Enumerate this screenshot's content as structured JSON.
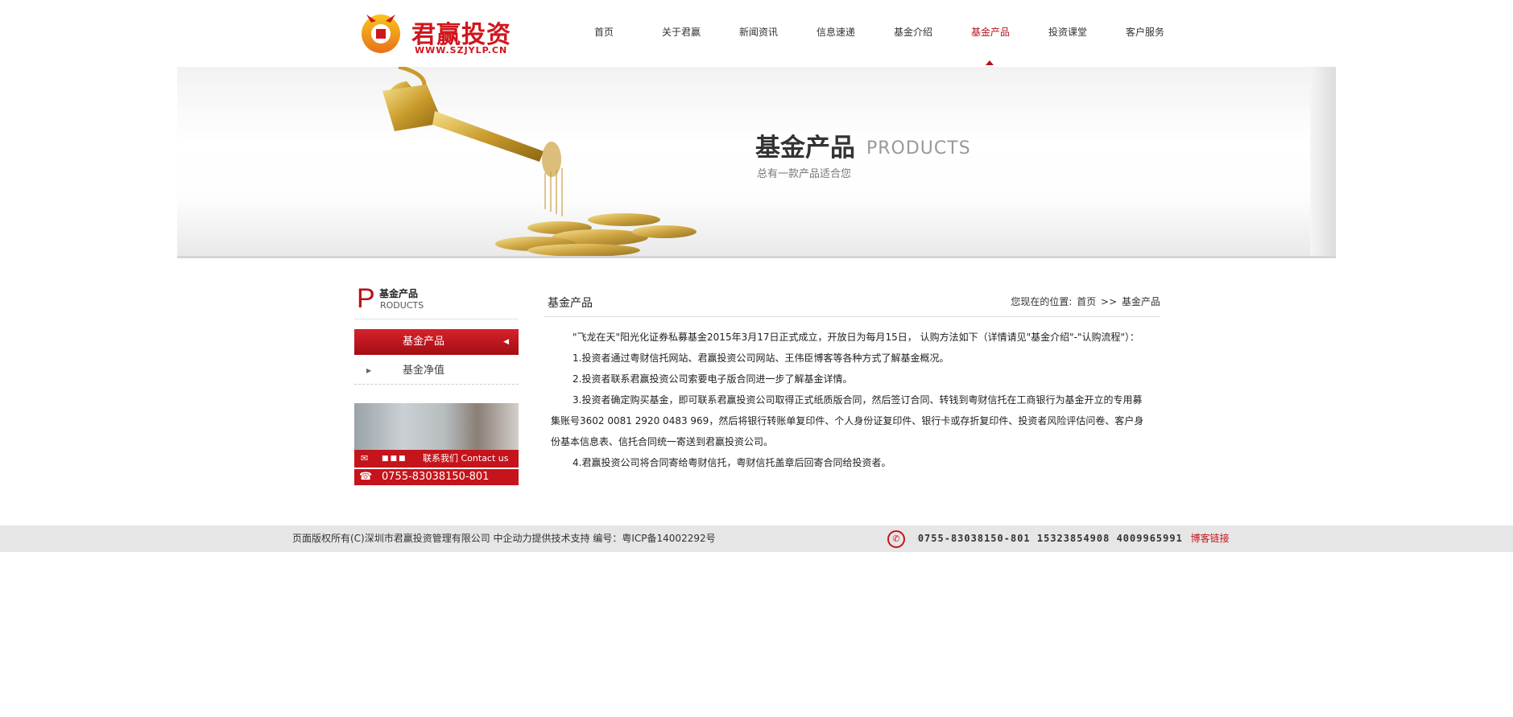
{
  "brand": {
    "name": "君赢投资",
    "url": "WWW.SZJYLP.CN",
    "color": "#d0161d"
  },
  "nav": [
    {
      "label": "首页"
    },
    {
      "label": "关于君赢"
    },
    {
      "label": "新闻资讯"
    },
    {
      "label": "信息速递"
    },
    {
      "label": "基金介绍"
    },
    {
      "label": "基金产品",
      "active": true
    },
    {
      "label": "投资课堂"
    },
    {
      "label": "客户服务"
    }
  ],
  "banner": {
    "title": "基金产品",
    "title_en": "PRODUCTS",
    "subtitle": "总有一款产品适合您"
  },
  "sidebar": {
    "head_p": "P",
    "head_cn": "基金产品",
    "head_en": "RODUCTS",
    "items": [
      {
        "label": "基金产品",
        "active": true
      },
      {
        "label": "基金净值"
      }
    ],
    "contact_label": "联系我们 Contact us",
    "contact_phone": "0755-83038150-801"
  },
  "main": {
    "title": "基金产品",
    "breadcrumb": {
      "prefix": "您现在的位置:",
      "home": "首页",
      "sep": ">>",
      "current": "基金产品"
    },
    "paragraphs": [
      "\"飞龙在天\"阳光化证券私募基金2015年3月17日正式成立，开放日为每月15日， 认购方法如下（详情请见\"基金介绍\"-\"认购流程\"）：",
      "1.投资者通过粤财信托网站、君赢投资公司网站、王伟臣博客等各种方式了解基金概况。",
      "2.投资者联系君赢投资公司索要电子版合同进一步了解基金详情。",
      "3.投资者确定购买基金，即可联系君赢投资公司取得正式纸质版合同，然后签订合同、转钱到粤财信托在工商银行为基金开立的专用募集账号3602 0081 2920 0483 969，然后将银行转账单复印件、个人身份证复印件、银行卡或存折复印件、投资者风险评估问卷、客户身份基本信息表、信托合同统一寄送到君赢投资公司。",
      "4.君赢投资公司将合同寄给粤财信托，粤财信托盖章后回寄合同给投资者。"
    ]
  },
  "footer": {
    "copyright": "页面版权所有(C)深圳市君赢投资管理有限公司  中企动力提供技术支持  编号：粤ICP备14002292号",
    "phones": "0755-83038150-801  15323854908  4009965991",
    "blog_link": "博客链接"
  }
}
